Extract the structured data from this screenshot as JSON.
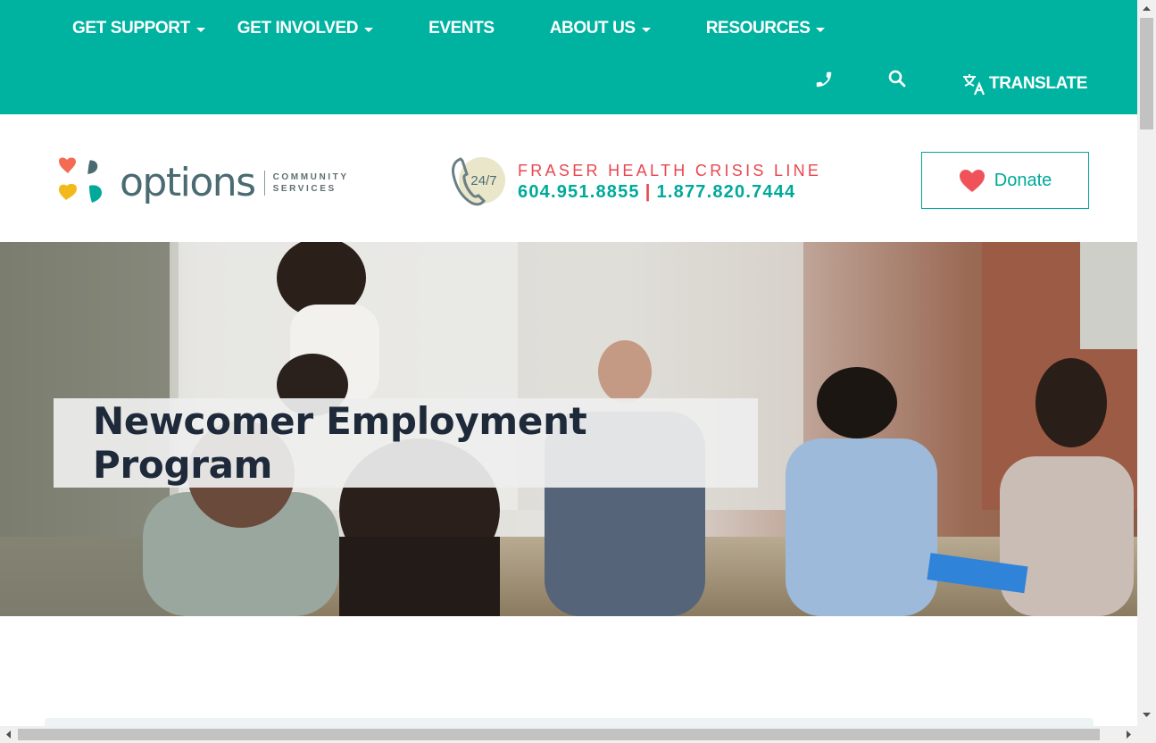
{
  "nav": {
    "menu": [
      {
        "label": "GET SUPPORT",
        "has_dropdown": true
      },
      {
        "label": "GET INVOLVED",
        "has_dropdown": true
      },
      {
        "label": "EVENTS",
        "has_dropdown": false
      },
      {
        "label": "ABOUT US",
        "has_dropdown": true
      },
      {
        "label": "RESOURCES",
        "has_dropdown": true
      }
    ],
    "phone_icon": "phone-icon",
    "search_icon": "search-icon",
    "translate_icon": "translate-icon",
    "translate_label": "TRANSLATE"
  },
  "header": {
    "logo": {
      "word": "options",
      "sub_line1": "COMMUNITY",
      "sub_line2": "SERVICES"
    },
    "crisis": {
      "badge": "24/7",
      "title": "FRASER HEALTH CRISIS LINE",
      "phone1": "604.951.8855",
      "separator": "|",
      "phone2": "1.877.820.7444"
    },
    "donate_label": "Donate"
  },
  "hero": {
    "title": "Newcomer Employment Program"
  },
  "colors": {
    "teal": "#00b3a1",
    "teal_text": "#00a99a",
    "coral": "#e8464f",
    "logo_text": "#4a6b72",
    "heart": "#f0525a"
  }
}
